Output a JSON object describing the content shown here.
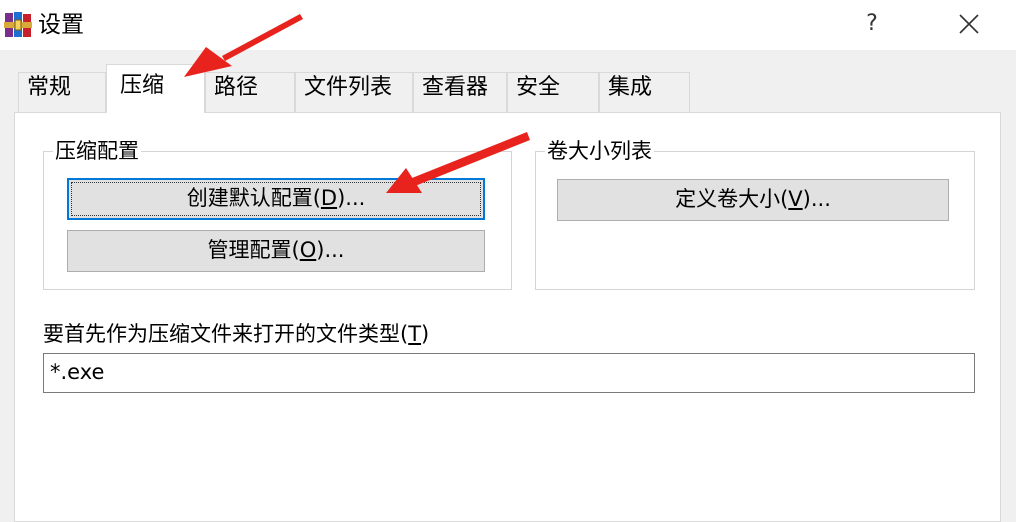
{
  "window": {
    "title": "设置",
    "help_glyph": "?",
    "close_icon": "close-icon",
    "app_icon": "winrar-books-icon"
  },
  "tabs": [
    {
      "label": "常规",
      "active": false
    },
    {
      "label": "压缩",
      "active": true
    },
    {
      "label": "路径",
      "active": false
    },
    {
      "label": "文件列表",
      "active": false
    },
    {
      "label": "查看器",
      "active": false
    },
    {
      "label": "安全",
      "active": false
    },
    {
      "label": "集成",
      "active": false
    }
  ],
  "compression_profiles": {
    "group_label": "压缩配置",
    "create_default": {
      "text": "创建默认配置(",
      "mnemonic": "D",
      "suffix": ")..."
    },
    "manage": {
      "text": "管理配置(",
      "mnemonic": "O",
      "suffix": ")..."
    }
  },
  "volume_sizes": {
    "group_label": "卷大小列表",
    "define": {
      "text": "定义卷大小(",
      "mnemonic": "V",
      "suffix": ")..."
    }
  },
  "archive_types": {
    "label_text": "要首先作为压缩文件来打开的文件类型(",
    "label_mnemonic": "T",
    "label_suffix": ")",
    "value": "*.exe"
  },
  "annotation": {
    "arrow_color": "#e8231d"
  }
}
